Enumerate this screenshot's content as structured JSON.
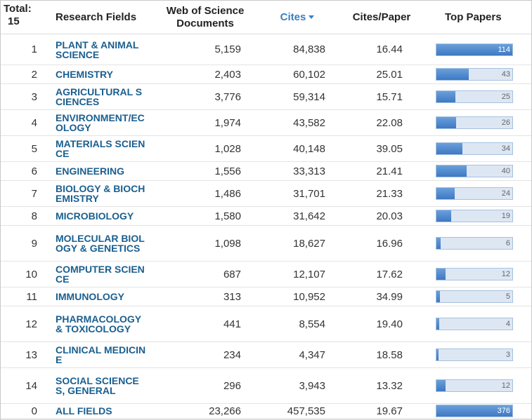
{
  "header": {
    "total_label": "Total:",
    "total_count": "15",
    "field_col": "Research Fields",
    "docs_col": "Web of Science Documents",
    "cites_col": "Cites",
    "cpp_col": "Cites/Paper",
    "top_col": "Top Papers"
  },
  "rows": [
    {
      "rank": "1",
      "field": "PLANT & ANIMAL SCIENCE",
      "docs": "5,159",
      "cites": "84,838",
      "cpp": "16.44",
      "top": "114",
      "top_value": 114
    },
    {
      "rank": "2",
      "field": "CHEMISTRY",
      "docs": "2,403",
      "cites": "60,102",
      "cpp": "25.01",
      "top": "43",
      "top_value": 43
    },
    {
      "rank": "3",
      "field": "AGRICULTURAL SCIENCES",
      "docs": "3,776",
      "cites": "59,314",
      "cpp": "15.71",
      "top": "25",
      "top_value": 25
    },
    {
      "rank": "4",
      "field": "ENVIRONMENT/ECOLOGY",
      "docs": "1,974",
      "cites": "43,582",
      "cpp": "22.08",
      "top": "26",
      "top_value": 26
    },
    {
      "rank": "5",
      "field": "MATERIALS SCIENCE",
      "docs": "1,028",
      "cites": "40,148",
      "cpp": "39.05",
      "top": "34",
      "top_value": 34
    },
    {
      "rank": "6",
      "field": "ENGINEERING",
      "docs": "1,556",
      "cites": "33,313",
      "cpp": "21.41",
      "top": "40",
      "top_value": 40
    },
    {
      "rank": "7",
      "field": "BIOLOGY & BIOCHEMISTRY",
      "docs": "1,486",
      "cites": "31,701",
      "cpp": "21.33",
      "top": "24",
      "top_value": 24
    },
    {
      "rank": "8",
      "field": "MICROBIOLOGY",
      "docs": "1,580",
      "cites": "31,642",
      "cpp": "20.03",
      "top": "19",
      "top_value": 19
    },
    {
      "rank": "9",
      "field": "MOLECULAR BIOLOGY & GENETICS",
      "docs": "1,098",
      "cites": "18,627",
      "cpp": "16.96",
      "top": "6",
      "top_value": 6
    },
    {
      "rank": "10",
      "field": "COMPUTER SCIENCE",
      "docs": "687",
      "cites": "12,107",
      "cpp": "17.62",
      "top": "12",
      "top_value": 12
    },
    {
      "rank": "11",
      "field": "IMMUNOLOGY",
      "docs": "313",
      "cites": "10,952",
      "cpp": "34.99",
      "top": "5",
      "top_value": 5
    },
    {
      "rank": "12",
      "field": "PHARMACOLOGY & TOXICOLOGY",
      "docs": "441",
      "cites": "8,554",
      "cpp": "19.40",
      "top": "4",
      "top_value": 4
    },
    {
      "rank": "13",
      "field": "CLINICAL MEDICINE",
      "docs": "234",
      "cites": "4,347",
      "cpp": "18.58",
      "top": "3",
      "top_value": 3
    },
    {
      "rank": "14",
      "field": "SOCIAL SCIENCES, GENERAL",
      "docs": "296",
      "cites": "3,943",
      "cpp": "13.32",
      "top": "12",
      "top_value": 12
    },
    {
      "rank": "0",
      "field": "ALL FIELDS",
      "docs": "23,266",
      "cites": "457,535",
      "cpp": "19.67",
      "top": "376",
      "top_value": 376
    }
  ],
  "top_bar_max": 100,
  "colors": {
    "link": "#1a5f8f",
    "sorted_header": "#3b7dc4",
    "bar_fill": "#4a86cf",
    "bar_track": "#dde7f3"
  }
}
